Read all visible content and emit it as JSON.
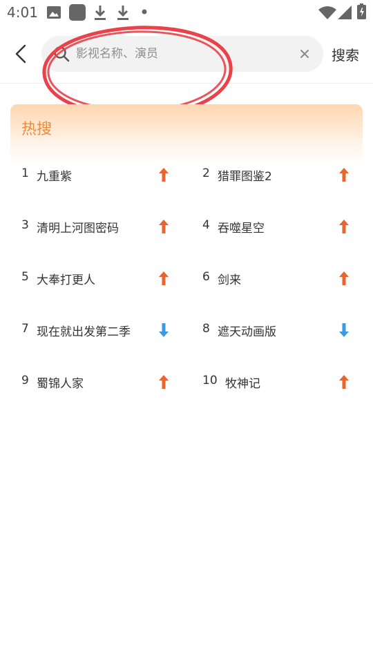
{
  "status_bar": {
    "time": "4:01",
    "icons": [
      "image-icon",
      "app-icon",
      "download-icon",
      "download-icon",
      "dot-icon",
      "wifi-icon",
      "signal-icon",
      "battery-icon"
    ]
  },
  "search": {
    "placeholder": "影视名称、演员",
    "value": "",
    "button_label": "搜索"
  },
  "hot": {
    "title": "热搜",
    "items": [
      {
        "rank": "1",
        "name": "九重紫",
        "trend": "up"
      },
      {
        "rank": "2",
        "name": "猎罪图鉴2",
        "trend": "up"
      },
      {
        "rank": "3",
        "name": "清明上河图密码",
        "trend": "up"
      },
      {
        "rank": "4",
        "name": "吞噬星空",
        "trend": "up"
      },
      {
        "rank": "5",
        "name": "大奉打更人",
        "trend": "up"
      },
      {
        "rank": "6",
        "name": "剑来",
        "trend": "up"
      },
      {
        "rank": "7",
        "name": "现在就出发第二季",
        "trend": "down"
      },
      {
        "rank": "8",
        "name": "遮天动画版",
        "trend": "down"
      },
      {
        "rank": "9",
        "name": "蜀锦人家",
        "trend": "up"
      },
      {
        "rank": "10",
        "name": "牧神记",
        "trend": "up"
      }
    ]
  },
  "colors": {
    "accent": "#f08a34",
    "trend_up": "#e8652f",
    "trend_down": "#3b9ae1",
    "annotation": "#e8424a"
  }
}
